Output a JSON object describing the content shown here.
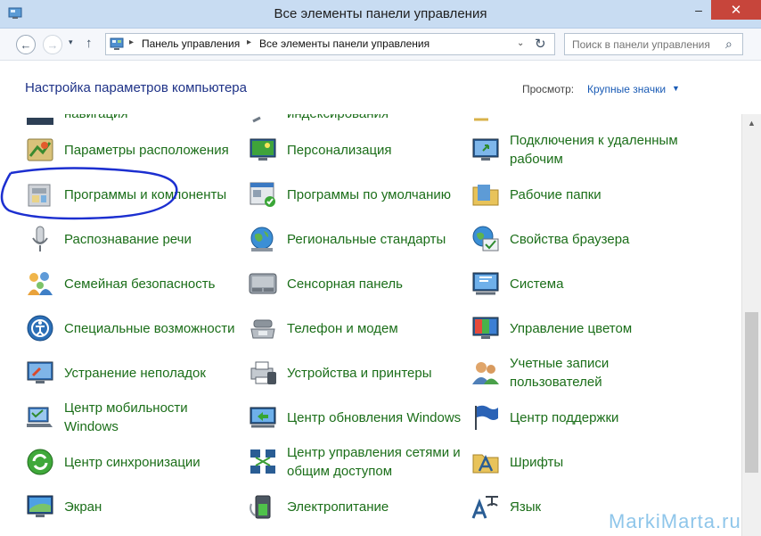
{
  "window": {
    "title": "Все элементы панели управления"
  },
  "controls": {
    "minimize": "–",
    "maximize": "□",
    "close": "✕"
  },
  "nav": {
    "back": "←",
    "forward": "→",
    "dropdown": "▾",
    "up": "↑"
  },
  "address": {
    "segments": [
      "Панель управления",
      "Все элементы панели управления"
    ],
    "separator": "▸",
    "dropdown": "⌄",
    "refresh": "↻"
  },
  "search": {
    "placeholder": "Поиск в панели управления",
    "icon": "⌕"
  },
  "header": {
    "title": "Настройка параметров компьютера",
    "view_label": "Просмотр:",
    "view_value": "Крупные значки",
    "view_caret": "▼"
  },
  "items": {
    "col1": [
      {
        "label": "навигация",
        "icon": "taskbar-navigation-icon"
      },
      {
        "label": "Параметры расположения",
        "icon": "location-settings-icon"
      },
      {
        "label": "Программы и компоненты",
        "icon": "programs-features-icon"
      },
      {
        "label": "Распознавание речи",
        "icon": "microphone-icon"
      },
      {
        "label": "Семейная безопасность",
        "icon": "family-safety-icon"
      },
      {
        "label": "Специальные возможности",
        "icon": "ease-of-access-icon"
      },
      {
        "label": "Устранение неполадок",
        "icon": "troubleshooting-icon"
      },
      {
        "label": "Центр мобильности Windows",
        "icon": "mobility-center-icon"
      },
      {
        "label": "Центр синхронизации",
        "icon": "sync-center-icon"
      },
      {
        "label": "Экран",
        "icon": "display-icon"
      }
    ],
    "col2": [
      {
        "label": "индексирования",
        "icon": "indexing-icon"
      },
      {
        "label": "Персонализация",
        "icon": "personalization-icon"
      },
      {
        "label": "Программы по умолчанию",
        "icon": "default-programs-icon"
      },
      {
        "label": "Региональные стандарты",
        "icon": "region-globe-icon"
      },
      {
        "label": "Сенсорная панель",
        "icon": "touchpad-icon"
      },
      {
        "label": "Телефон и модем",
        "icon": "phone-modem-icon"
      },
      {
        "label": "Устройства и принтеры",
        "icon": "devices-printers-icon"
      },
      {
        "label": "Центр обновления Windows",
        "icon": "windows-update-icon"
      },
      {
        "label": "Центр управления сетями и общим доступом",
        "icon": "network-sharing-icon"
      },
      {
        "label": "Электропитание",
        "icon": "power-options-icon"
      }
    ],
    "col3": [
      {
        "label": "",
        "icon": "folder-partial-icon"
      },
      {
        "label": "Подключения к удаленным рабочим",
        "icon": "remote-desktop-icon"
      },
      {
        "label": "Рабочие папки",
        "icon": "work-folders-icon"
      },
      {
        "label": "Свойства браузера",
        "icon": "internet-options-icon"
      },
      {
        "label": "Система",
        "icon": "system-icon"
      },
      {
        "label": "Управление цветом",
        "icon": "color-management-icon"
      },
      {
        "label": "Учетные записи пользователей",
        "icon": "user-accounts-icon"
      },
      {
        "label": "Центр поддержки",
        "icon": "action-center-flag-icon"
      },
      {
        "label": "Шрифты",
        "icon": "fonts-icon"
      },
      {
        "label": "Язык",
        "icon": "language-icon"
      }
    ]
  },
  "watermark": "MarkiMarta.ru",
  "colors": {
    "link_green": "#1b6e19",
    "header_blue": "#1e3287",
    "annotation": "#1c2fd0",
    "close_red": "#c7453b"
  }
}
